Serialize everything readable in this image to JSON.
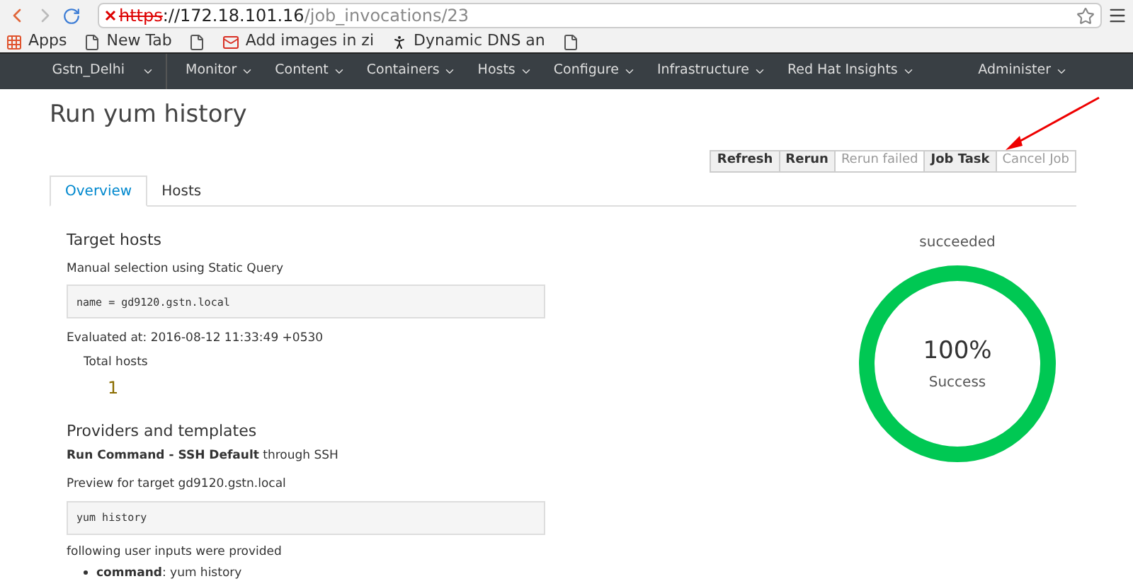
{
  "browser": {
    "url": {
      "scheme": "https",
      "host": "://172.18.101.16",
      "path": "/job_invocations/23"
    },
    "bookmarks": [
      {
        "kind": "apps",
        "label": "Apps"
      },
      {
        "kind": "page",
        "label": "New Tab"
      },
      {
        "kind": "page"
      },
      {
        "kind": "mail",
        "label": "Add images in zi"
      },
      {
        "kind": "figure",
        "label": "Dynamic DNS an"
      },
      {
        "kind": "page"
      }
    ]
  },
  "navbar": {
    "organization": "Gstn_Delhi",
    "menus": [
      "Monitor",
      "Content",
      "Containers",
      "Hosts",
      "Configure",
      "Infrastructure",
      "Red Hat Insights"
    ],
    "user_menu": "Administer"
  },
  "page": {
    "title": "Run yum history",
    "actions": [
      {
        "label": "Refresh",
        "disabled": false
      },
      {
        "label": "Rerun",
        "disabled": false
      },
      {
        "label": "Rerun failed",
        "disabled": true
      },
      {
        "label": "Job Task",
        "disabled": false
      },
      {
        "label": "Cancel Job",
        "disabled": true
      }
    ],
    "tabs": [
      {
        "label": "Overview",
        "selected": true
      },
      {
        "label": "Hosts",
        "selected": false
      }
    ],
    "target_hosts": {
      "heading": "Target hosts",
      "description": "Manual selection using Static Query",
      "query": "name = gd9120.gstn.local",
      "evaluated": "Evaluated at: 2016-08-12 11:33:49 +0530",
      "total_label": "Total hosts",
      "total_value": "1"
    },
    "providers": {
      "heading": "Providers and templates",
      "template": "**Run Command - SSH Default** through SSH",
      "preview_label": "Preview for target gd9120.gstn.local",
      "preview": "yum history",
      "inputs_label": "following user inputs were provided",
      "inputs": [
        "**command**: yum history"
      ]
    },
    "status": {
      "label": "succeeded",
      "level": 1,
      "percent": "100%",
      "caption": "Success"
    }
  }
}
